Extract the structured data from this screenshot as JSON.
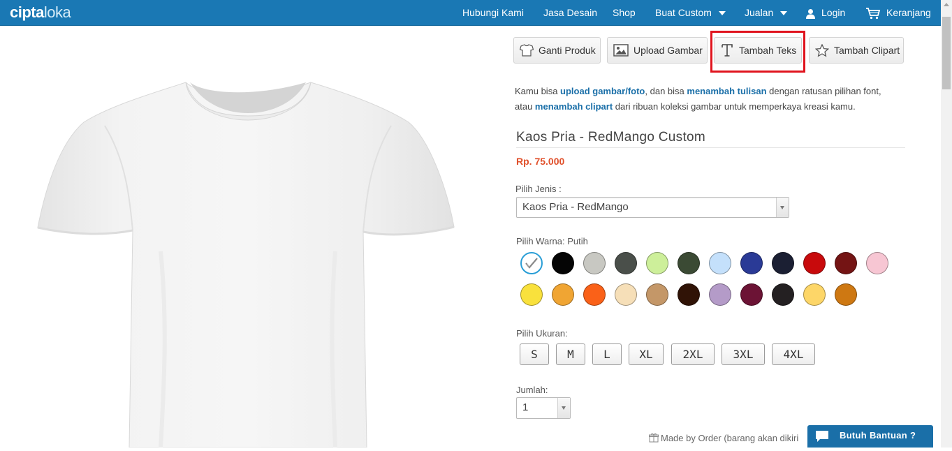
{
  "brand": {
    "logo_bold": "cipta",
    "logo_light": "loka"
  },
  "nav": {
    "contact": "Hubungi Kami",
    "design": "Jasa Desain",
    "shop": "Shop",
    "custom": "Buat Custom",
    "sell": "Jualan",
    "login": "Login",
    "cart": "Keranjang"
  },
  "tools": {
    "change_product": "Ganti Produk",
    "upload_image": "Upload Gambar",
    "add_text": "Tambah Teks",
    "add_clipart": "Tambah Clipart"
  },
  "intro": {
    "t1": "Kamu bisa ",
    "l1": "upload gambar/foto",
    "t2": ", dan bisa ",
    "l2": "menambah tulisan",
    "t3": " dengan ratusan pilihan font,",
    "t4": "atau ",
    "l3": "menambah clipart",
    "t5": " dari ribuan koleksi gambar untuk memperkaya kreasi kamu."
  },
  "product": {
    "title": "Kaos Pria - RedMango Custom",
    "price": "Rp. 75.000",
    "type_label": "Pilih Jenis :",
    "type_value": "Kaos Pria - RedMango",
    "color_label": "Pilih Warna: Putih",
    "size_label": "Pilih Ukuran:",
    "qty_label": "Jumlah:",
    "qty_value": "1"
  },
  "colors": [
    "#ffffff",
    "#050505",
    "#c8c8c2",
    "#4a4f4a",
    "#cdef9a",
    "#3b4a34",
    "#c4e0fb",
    "#2a3a96",
    "#1b1f33",
    "#c80a0c",
    "#741414",
    "#f7c6d3",
    "#f9e13c",
    "#f0a533",
    "#fa6118",
    "#f6dfb8",
    "#c49768",
    "#301306",
    "#b49bc8",
    "#6c1335",
    "#242022",
    "#fdd668",
    "#ce7812"
  ],
  "sizes": [
    "S",
    "M",
    "L",
    "XL",
    "2XL",
    "3XL",
    "4XL"
  ],
  "footer": {
    "made_order": "Made by Order (barang akan dikiri",
    "help": "Butuh Bantuan ?"
  }
}
